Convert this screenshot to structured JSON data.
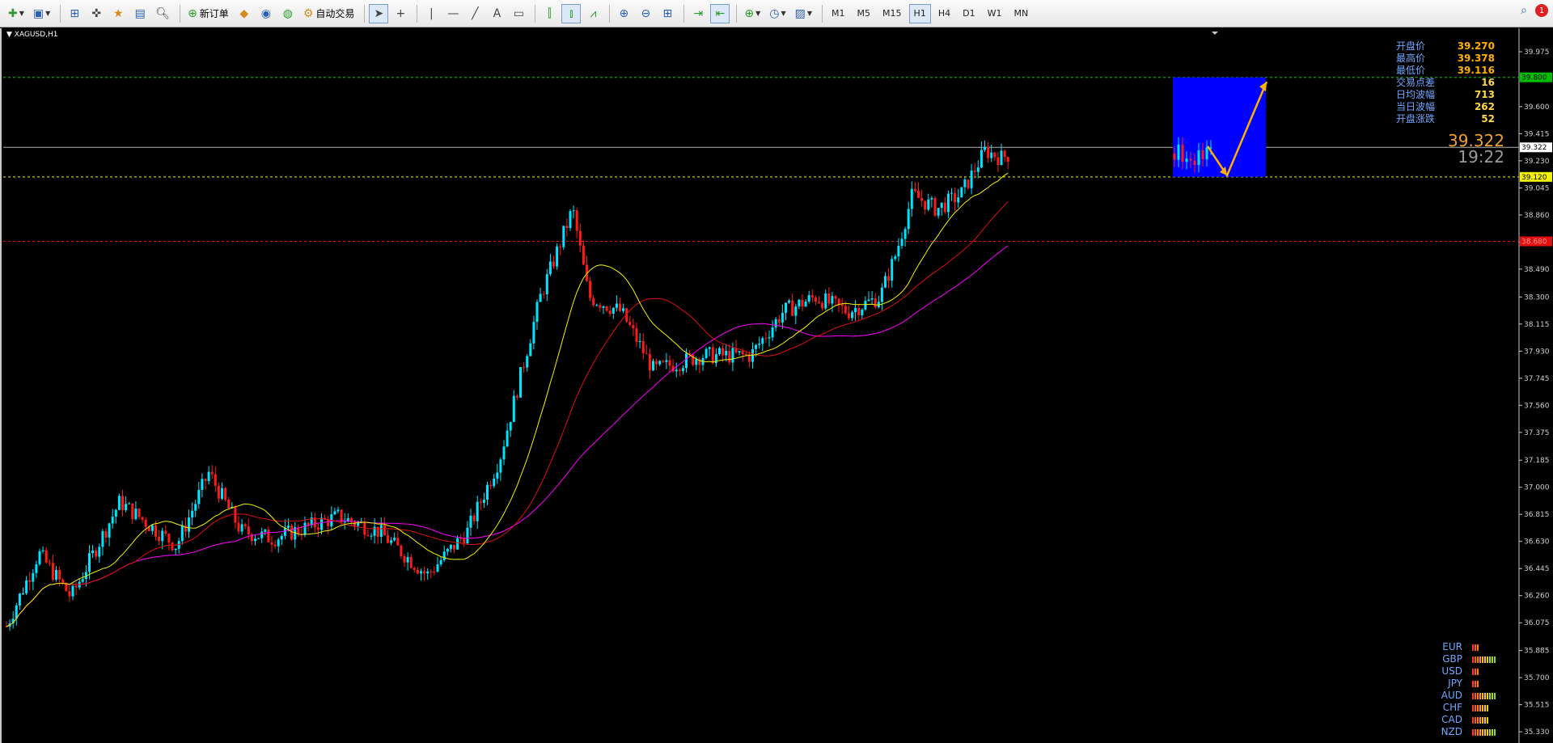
{
  "toolbar": {
    "new_order_label": "新订单",
    "auto_trade_label": "自动交易",
    "timeframes": [
      "M1",
      "M5",
      "M15",
      "H1",
      "H4",
      "D1",
      "W1",
      "MN"
    ],
    "active_timeframe": "H1",
    "notification_count": "1"
  },
  "chart": {
    "symbol_label": "XAGUSD,H1",
    "current_price": "39.322",
    "countdown": "19:22",
    "price_axis_ticks": [
      "39.975",
      "39.600",
      "39.415",
      "39.230",
      "39.045",
      "38.860",
      "38.675",
      "38.490",
      "38.300",
      "38.115",
      "37.930",
      "37.745",
      "37.560",
      "37.375",
      "37.185",
      "37.000",
      "36.815",
      "36.630",
      "36.445",
      "36.260",
      "36.075",
      "35.885",
      "35.700",
      "35.515",
      "35.330"
    ],
    "level_labels": {
      "green": "39.800",
      "current": "39.322",
      "yellow": "39.120",
      "red": "38.680"
    },
    "colors": {
      "bull_candle": "#00e5ff",
      "bear_candle": "#ff1a1a",
      "ma_fast": "#f2f200",
      "ma_mid": "#e01010",
      "ma_slow": "#ff00ff",
      "box": "#0000ff",
      "arrows": "#ffb000"
    }
  },
  "info_panel": [
    {
      "label": "开盘价",
      "value": "39.270",
      "color": "#ffb000"
    },
    {
      "label": "最高价",
      "value": "39.378",
      "color": "#ffb000"
    },
    {
      "label": "最低价",
      "value": "39.116",
      "color": "#ffb000"
    },
    {
      "label": "交易点差",
      "value": "16",
      "color": "#ffd84a"
    },
    {
      "label": "日均波幅",
      "value": "713",
      "color": "#ffd84a"
    },
    {
      "label": "当日波幅",
      "value": "262",
      "color": "#ffd84a"
    },
    {
      "label": "开盘涨跌",
      "value": "52",
      "color": "#ffd84a"
    }
  ],
  "currency_strength": [
    {
      "label": "EUR",
      "level": 3
    },
    {
      "label": "GBP",
      "level": 10
    },
    {
      "label": "USD",
      "level": 3
    },
    {
      "label": "JPY",
      "level": 3
    },
    {
      "label": "AUD",
      "level": 10
    },
    {
      "label": "CHF",
      "level": 7
    },
    {
      "label": "CAD",
      "level": 7
    },
    {
      "label": "NZD",
      "level": 10
    }
  ]
}
